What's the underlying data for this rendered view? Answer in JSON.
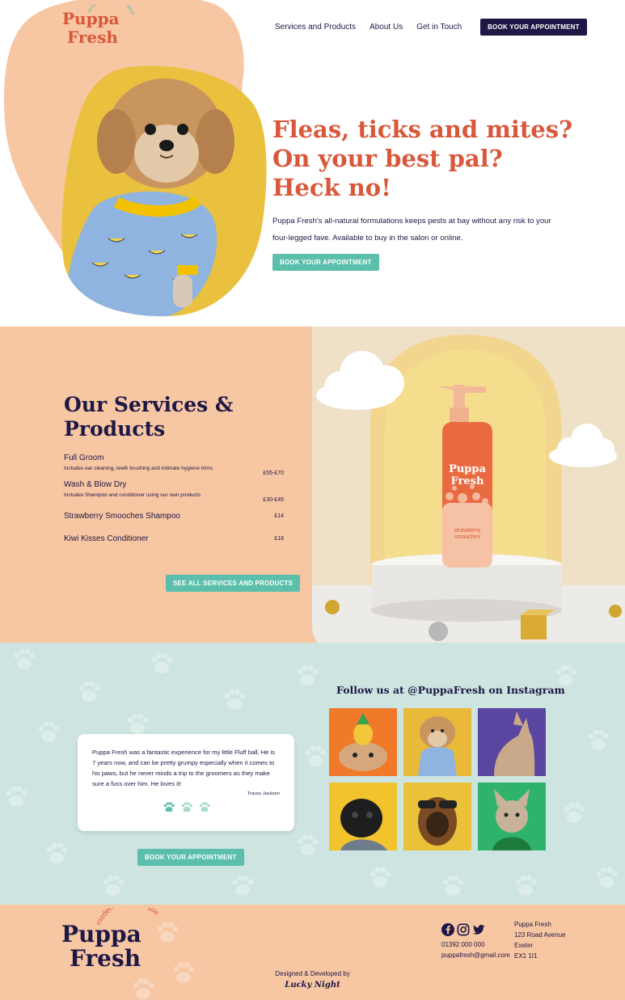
{
  "brand": {
    "logo_word1": "Puppa",
    "logo_word2": "Fresh",
    "logo_tagline": "modern dog boutique",
    "colors": {
      "navy": "#1d1845",
      "orange": "#d9573a",
      "peach": "#f7c6a3",
      "teal": "#5bbfac",
      "mint": "#cde4e0",
      "yellow": "#e9b93a"
    }
  },
  "nav": {
    "items": [
      "Services and Products",
      "About Us",
      "Get in Touch"
    ],
    "cta": "BOOK YOUR APPOINTMENT"
  },
  "hero": {
    "headline_lines": [
      "Fleas, ticks and mites?",
      "On your best pal?",
      "Heck no!"
    ],
    "body": "Puppa Fresh's all-natural formulations keeps pests at bay without any risk to your four-legged fave. Available to buy in the salon or online.",
    "cta": "BOOK YOUR APPOINTMENT",
    "image_icon": "dog-in-banana-pyjamas-photo"
  },
  "services": {
    "title_line1": "Our Services &",
    "title_line2": "Products",
    "items": [
      {
        "name": "Full Groom",
        "description": "Includes ear cleaning, teeth brushing and intimate hygiene trims",
        "price": "£55-£70"
      },
      {
        "name": "Wash & Blow Dry",
        "description": "Includes Shampoo and conditioner using our own products",
        "price": "£30-£45"
      },
      {
        "name": "Strawberry Smooches Shampoo",
        "description": "",
        "price": "£14"
      },
      {
        "name": "Kiwi Kisses Conditioner",
        "description": "",
        "price": "£18"
      }
    ],
    "cta": "SEE ALL SERVICES AND PRODUCTS",
    "product_label_line1": "strawberry",
    "product_label_line2": "smooches"
  },
  "testimonial": {
    "text": "Puppa Fresh was a fantastic experience for my little Fluff ball. He is 7 years now, and can be pretty grumpy especially when it comes to his paws, but he never minds a trip to the groomers as they make sure a fuss over him. He loves it!",
    "author": "Tracey Jackson",
    "cta": "BOOK YOUR APPOINTMENT"
  },
  "instagram": {
    "title": "Follow us at @PuppaFresh on Instagram",
    "tiles": [
      {
        "icon": "bulldog-pineapple-hat-photo",
        "bg": "#f07a2a"
      },
      {
        "icon": "dog-banana-pyjamas-photo",
        "bg": "#e9b93a"
      },
      {
        "icon": "chihuahua-purple-photo",
        "bg": "#5a46a0"
      },
      {
        "icon": "pug-yellow-photo",
        "bg": "#f1c42e"
      },
      {
        "icon": "dog-sunglasses-photo",
        "bg": "#e9c23a"
      },
      {
        "icon": "french-bulldog-green-photo",
        "bg": "#2fb36a"
      }
    ]
  },
  "footer": {
    "social_icons": [
      "facebook-icon",
      "instagram-icon",
      "twitter-icon"
    ],
    "phone": "01392 000 000",
    "email": "puppafresh@gmail.com",
    "address": {
      "line1": "Puppa Fresh",
      "line2": "123 Road Avenue",
      "line3": "Exeter",
      "line4": "EX1 1I1"
    },
    "credit_label": "Designed & Developed by",
    "credit_brand": "Lucky Night"
  }
}
